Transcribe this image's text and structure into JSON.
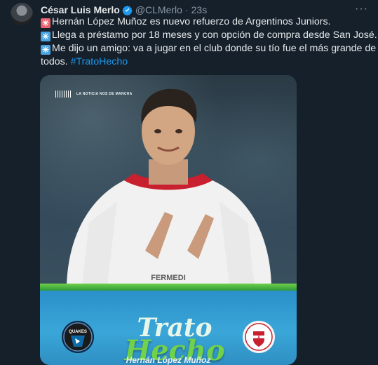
{
  "tweet": {
    "author": "César Luis Merlo",
    "handle": "@CLMerlo",
    "dot": "·",
    "time": "23s",
    "more": "···",
    "lines": [
      {
        "emoji": "✳",
        "emoji_color": "red",
        "text": "Hernán López Muñoz es nuevo refuerzo de Argentinos Juniors."
      },
      {
        "emoji": "✳",
        "emoji_color": "blue",
        "text": "Llega a préstamo por 18 meses y con opción de compra desde San José."
      },
      {
        "emoji": "✳",
        "emoji_color": "blue",
        "text": "Me dijo un amigo: va a jugar en el club donde su tío fue el más grande de"
      }
    ],
    "last_line": "todos.",
    "hashtag": "#TratoHecho"
  },
  "media": {
    "brand": "LA NOTICIA NOS DE MANCHA",
    "trato_word1": "Trato",
    "trato_word2": "Hecho",
    "player_name": "Hernán López Muñoz",
    "club_left": "QUAKES",
    "club_right": "Argentinos Juniors"
  },
  "colors": {
    "background": "#15202b",
    "link": "#1d9bf0",
    "verified": "#1d9bf0",
    "green": "#6fd24a",
    "blue": "#2b90c9"
  }
}
